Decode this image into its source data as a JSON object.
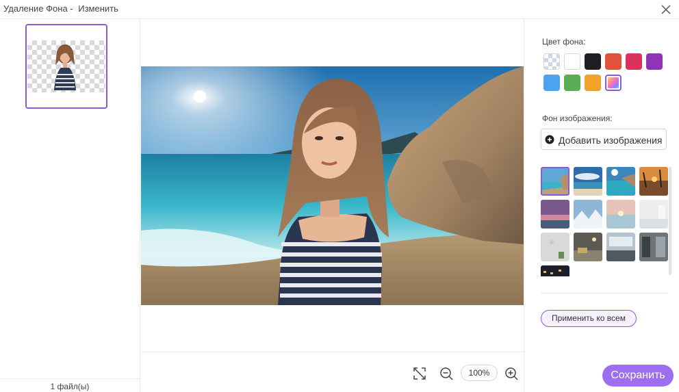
{
  "window": {
    "title_part1": "Удаление Фона -",
    "title_part2": "Изменить"
  },
  "left_panel": {
    "file_count": "1 файл(ы)"
  },
  "center": {
    "zoom_level": "100%"
  },
  "right_panel": {
    "bg_color_label": "Цвет фона:",
    "bg_image_label": "Фон изображения:",
    "add_image_label": "Добавить изображения",
    "apply_all_label": "Применить ко всем",
    "swatches": [
      {
        "name": "transparent",
        "color": "checker"
      },
      {
        "name": "white",
        "color": "#ffffff"
      },
      {
        "name": "black",
        "color": "#1d1d22"
      },
      {
        "name": "orange-red",
        "color": "#e2533d"
      },
      {
        "name": "crimson",
        "color": "#d9325b"
      },
      {
        "name": "purple",
        "color": "#8e34b7"
      },
      {
        "name": "blue",
        "color": "#4da3ee"
      },
      {
        "name": "green",
        "color": "#5aad54"
      },
      {
        "name": "amber",
        "color": "#f2a12d"
      },
      {
        "name": "rainbow",
        "color": "gradient"
      }
    ],
    "background_presets": [
      "beach-cliffs",
      "beach-clouds",
      "sea-sun",
      "sunset",
      "pink-sunset",
      "snowy-mountains",
      "ocean-dusk",
      "white-studio",
      "minimal-room",
      "office-lounge",
      "office-desk",
      "library",
      "night-city"
    ]
  },
  "footer": {
    "save_label": "Сохранить"
  },
  "colors": {
    "accent": "#9b6ff0",
    "accent_border": "#8b5bd6"
  }
}
